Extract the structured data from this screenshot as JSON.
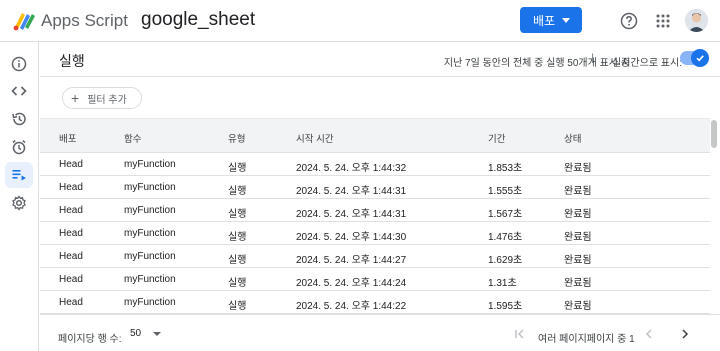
{
  "header": {
    "app_name": "Apps Script",
    "project_name": "google_sheet",
    "deploy_label": "배포",
    "help_icon": "help-icon",
    "apps_icon": "apps-grid-icon"
  },
  "colors": {
    "accent": "#1a73e8",
    "nav_active_bg": "#e8f0fe",
    "header_row_bg": "#f1f3f4"
  },
  "sidenav": {
    "items": [
      {
        "icon": "info-icon",
        "active": false
      },
      {
        "icon": "code-icon",
        "active": false
      },
      {
        "icon": "history-icon",
        "active": false
      },
      {
        "icon": "alarm-icon",
        "active": false
      },
      {
        "icon": "executions-icon",
        "active": true
      },
      {
        "icon": "settings-icon",
        "active": false
      }
    ]
  },
  "main": {
    "title": "실행",
    "summary": "지난 7일 동안의 전체 중 실행 50개개 표시 중",
    "separator": "|",
    "realtime_label": "실시간으로 표시:",
    "realtime_enabled": true,
    "filter_label": "필터 추가"
  },
  "table": {
    "columns": [
      "배포",
      "함수",
      "유형",
      "시작 시간",
      "기간",
      "상태"
    ],
    "rows": [
      [
        "Head",
        "myFunction",
        "실행",
        "2024. 5. 24. 오후 1:44:32",
        "1.853초",
        "완료됨"
      ],
      [
        "Head",
        "myFunction",
        "실행",
        "2024. 5. 24. 오후 1:44:31",
        "1.555초",
        "완료됨"
      ],
      [
        "Head",
        "myFunction",
        "실행",
        "2024. 5. 24. 오후 1:44:31",
        "1.567초",
        "완료됨"
      ],
      [
        "Head",
        "myFunction",
        "실행",
        "2024. 5. 24. 오후 1:44:30",
        "1.476초",
        "완료됨"
      ],
      [
        "Head",
        "myFunction",
        "실행",
        "2024. 5. 24. 오후 1:44:27",
        "1.629초",
        "완료됨"
      ],
      [
        "Head",
        "myFunction",
        "실행",
        "2024. 5. 24. 오후 1:44:24",
        "1.31초",
        "완료됨"
      ],
      [
        "Head",
        "myFunction",
        "실행",
        "2024. 5. 24. 오후 1:44:22",
        "1.595초",
        "완료됨"
      ]
    ]
  },
  "footer": {
    "rows_per_page_label": "페이지당 행 수:",
    "rows_per_page_value": "50",
    "page_info": "여러 페이지페이지 중 1"
  }
}
